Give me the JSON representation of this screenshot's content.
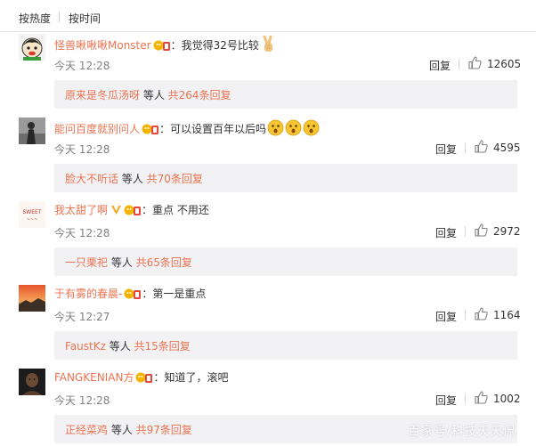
{
  "sort": {
    "hot": "按热度",
    "time": "按时间"
  },
  "comments": [
    {
      "user": "怪兽啾啾啾Monster",
      "text": "：我觉得32号比较",
      "time": "今天 12:28",
      "reply_label": "回复",
      "likes": "12605",
      "sub_user": "原来是冬瓜汤呀",
      "sub_mid": " 等人 ",
      "sub_count": "共264条回复"
    },
    {
      "user": "能问百度就别问人",
      "text": "：可以设置百年以后吗",
      "time": "今天 12:28",
      "reply_label": "回复",
      "likes": "4595",
      "sub_user": "脸大不听话",
      "sub_mid": " 等人 ",
      "sub_count": "共70条回复"
    },
    {
      "user": "我太甜了啊",
      "text": "：重点  不用还",
      "time": "今天 12:28",
      "reply_label": "回复",
      "likes": "2972",
      "sub_user": "一只栗祀",
      "sub_mid": " 等人 ",
      "sub_count": "共65条回复"
    },
    {
      "user": "于有雾的春晨-",
      "text": "：第一是重点",
      "time": "今天 12:27",
      "reply_label": "回复",
      "likes": "1164",
      "sub_user": "FaustKz",
      "sub_mid": " 等人 ",
      "sub_count": "共15条回复"
    },
    {
      "user": "FANGKENIAN方",
      "text": "：知道了，滚吧",
      "time": "今天 12:28",
      "reply_label": "回复",
      "likes": "1002",
      "sub_user": "正经菜鸡",
      "sub_mid": " 等人 ",
      "sub_count": "共97条回复"
    }
  ],
  "watermark": "百家号/科技天天侃",
  "colors": {
    "accent": "#eb7350",
    "sub_bg": "#f2f2f5",
    "time": "#808080"
  }
}
